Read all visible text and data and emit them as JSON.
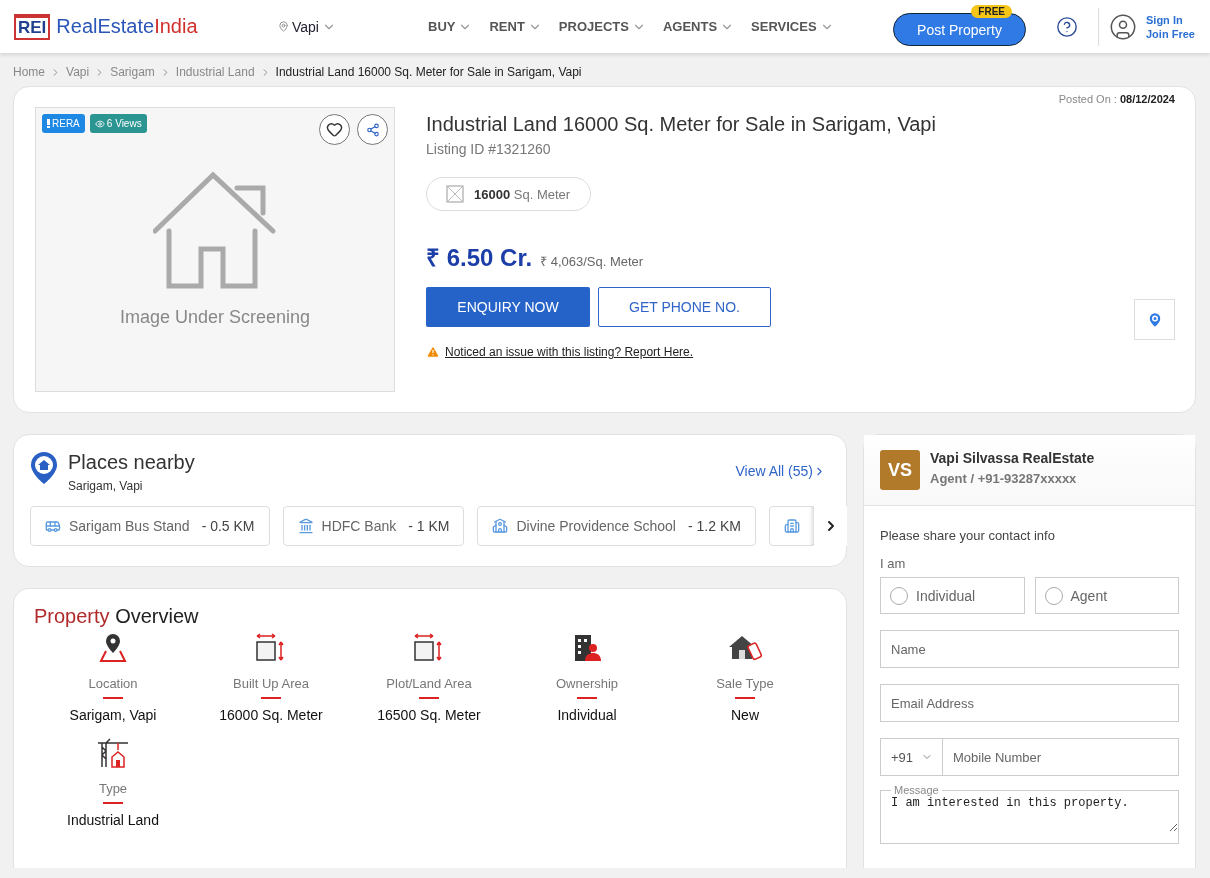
{
  "header": {
    "logo": {
      "mark": "REI",
      "name_start": "RealEstate",
      "name_end": "India"
    },
    "city": "Vapi",
    "nav": [
      "BUY",
      "RENT",
      "PROJECTS",
      "AGENTS",
      "SERVICES"
    ],
    "post_button": "Post Property",
    "post_badge": "FREE",
    "sign_in": "Sign In",
    "join": "Join Free"
  },
  "breadcrumb": [
    "Home",
    "Vapi",
    "Sarigam",
    "Industrial Land",
    "Industrial Land 16000 Sq. Meter for Sale in Sarigam, Vapi"
  ],
  "listing": {
    "rera": "RERA",
    "views": "6 Views",
    "image_text": "Image Under Screening",
    "posted_label": "Posted On :",
    "posted_date": "08/12/2024",
    "title": "Industrial Land 16000 Sq. Meter for Sale in Sarigam, Vapi",
    "listing_id": "Listing ID #1321260",
    "area_value": "16000",
    "area_unit": "Sq. Meter",
    "price": "₹ 6.50 Cr.",
    "rate": "₹ 4,063/Sq. Meter",
    "enquiry_button": "ENQUIRY NOW",
    "phone_button": "GET PHONE NO.",
    "report_link": "Noticed an issue with this listing? Report Here."
  },
  "places": {
    "title": "Places nearby",
    "subtitle": "Sarigam, Vapi",
    "view_all": "View All (55)",
    "items": [
      {
        "kind": "bus",
        "name": "Sarigam Bus Stand",
        "distance": "- 0.5 KM"
      },
      {
        "kind": "bank",
        "name": "HDFC Bank",
        "distance": "- 1 KM"
      },
      {
        "kind": "school",
        "name": "Divine Providence School",
        "distance": "- 1.2 KM"
      }
    ]
  },
  "overview": {
    "title_start": "Property",
    "title_end": "Overview",
    "items": [
      {
        "kind": "location",
        "label": "Location",
        "value": "Sarigam, Vapi"
      },
      {
        "kind": "area",
        "label": "Built Up Area",
        "value": "16000 Sq. Meter"
      },
      {
        "kind": "area",
        "label": "Plot/Land Area",
        "value": "16500 Sq. Meter"
      },
      {
        "kind": "ownership",
        "label": "Ownership",
        "value": "Individual"
      },
      {
        "kind": "sale",
        "label": "Sale Type",
        "value": "New"
      },
      {
        "kind": "type",
        "label": "Type",
        "value": "Industrial Land"
      }
    ]
  },
  "contact": {
    "initials": "VS",
    "agent_name": "Vapi Silvassa RealEstate",
    "agent_line": "Agent / +91-93287xxxxx",
    "prompt": "Please share your contact info",
    "iam_label": "I am",
    "roles": [
      {
        "label": "Individual",
        "selected": false
      },
      {
        "label": "Agent",
        "selected": false
      }
    ],
    "name_placeholder": "Name",
    "email_placeholder": "Email Address",
    "country_code": "+91",
    "mobile_placeholder": "Mobile Number",
    "message_label": "Message",
    "message": "I am interested in this property."
  }
}
